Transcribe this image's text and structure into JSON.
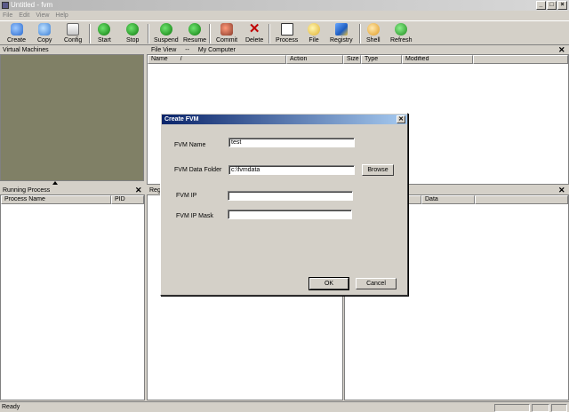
{
  "window": {
    "title": "Untitled - fvm"
  },
  "menu": [
    "File",
    "Edit",
    "View",
    "Help"
  ],
  "toolbar": [
    {
      "label": "Create",
      "icon": "create-icon"
    },
    {
      "label": "Copy",
      "icon": "copy-icon"
    },
    {
      "label": "Config",
      "icon": "config-icon"
    },
    {
      "label": "Start",
      "icon": "start-icon"
    },
    {
      "label": "Stop",
      "icon": "stop-icon"
    },
    {
      "label": "Suspend",
      "icon": "suspend-icon"
    },
    {
      "label": "Resume",
      "icon": "resume-icon"
    },
    {
      "label": "Commit",
      "icon": "commit-icon"
    },
    {
      "label": "Delete",
      "icon": "delete-icon"
    },
    {
      "label": "Process",
      "icon": "process-icon"
    },
    {
      "label": "File",
      "icon": "file-icon"
    },
    {
      "label": "Registry",
      "icon": "registry-icon"
    },
    {
      "label": "Shell",
      "icon": "shell-icon"
    },
    {
      "label": "Refresh",
      "icon": "refresh-icon"
    }
  ],
  "panes": {
    "virtual_machines": "Virtual Machines",
    "file_view": "File View",
    "file_view_path_sep": "--",
    "file_view_path": "My Computer",
    "file_columns": [
      "Name",
      "Action",
      "Size",
      "Type",
      "Modified"
    ],
    "running_process": "Running Process",
    "process_columns": [
      "Process Name",
      "PID"
    ],
    "registry_label": "Regi",
    "registry_data_column": "Data"
  },
  "status": {
    "text": "Ready"
  },
  "dialog": {
    "title": "Create FVM",
    "fields": {
      "name_label": "FVM Name",
      "name_value": "test",
      "folder_label": "FVM Data Folder",
      "folder_value": "c:\\fvmdata",
      "ip_label": "FVM IP",
      "ip_value": "",
      "mask_label": "FVM IP Mask",
      "mask_value": ""
    },
    "browse": "Browse",
    "ok": "OK",
    "cancel": "Cancel"
  }
}
